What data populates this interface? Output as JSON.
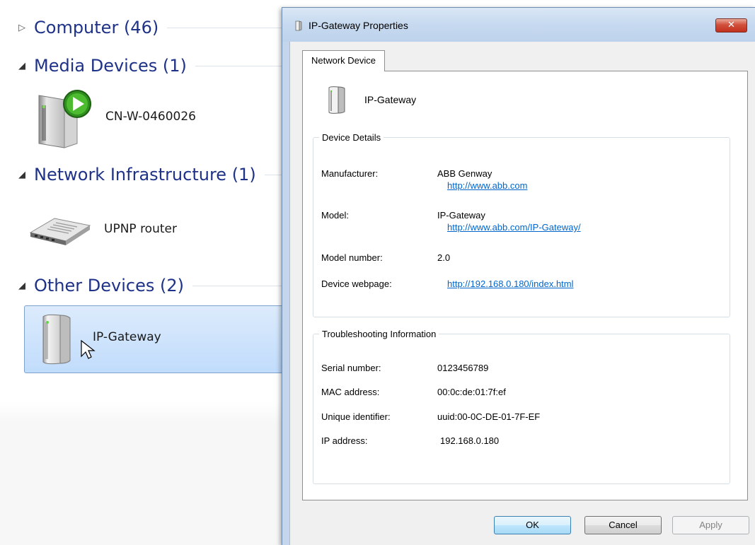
{
  "explorer": {
    "groups": [
      {
        "label": "Computer (46)",
        "expanded": false
      },
      {
        "label": "Media Devices (1)",
        "expanded": true,
        "items": [
          "CN-W-0460026"
        ]
      },
      {
        "label": "Network Infrastructure (1)",
        "expanded": true,
        "items": [
          "UPNP router"
        ]
      },
      {
        "label": "Other Devices (2)",
        "expanded": true,
        "items": [
          "IP-Gateway"
        ]
      }
    ],
    "selected_item": "IP-Gateway"
  },
  "dialog": {
    "title": "IP-Gateway Properties",
    "close_glyph": "✕",
    "tab_label": "Network Device",
    "device_name": "IP-Gateway",
    "device_details": {
      "legend": "Device Details",
      "manufacturer_label": "Manufacturer:",
      "manufacturer_value": "ABB Genway",
      "manufacturer_link": "http://www.abb.com",
      "model_label": "Model:",
      "model_value": "IP-Gateway",
      "model_link": "http://www.abb.com/IP-Gateway/",
      "model_number_label": "Model number:",
      "model_number_value": "2.0",
      "webpage_label": "Device webpage:",
      "webpage_link": "http://192.168.0.180/index.html"
    },
    "troubleshooting": {
      "legend": "Troubleshooting Information",
      "serial_label": "Serial number:",
      "serial_value": "0123456789",
      "mac_label": "MAC address:",
      "mac_value": "00:0c:de:01:7f:ef",
      "uid_label": "Unique identifier:",
      "uid_value": "uuid:00-0C-DE-01-7F-EF",
      "ip_label": "IP address:",
      "ip_value": "192.168.0.180"
    },
    "buttons": {
      "ok": "OK",
      "cancel": "Cancel",
      "apply": "Apply"
    }
  },
  "icons": {
    "collapsed_arrow": "collapsed-arrow-icon",
    "expanded_arrow": "expanded-arrow-icon",
    "media_device": "media-device-icon",
    "router": "router-icon",
    "gateway": "gateway-device-icon",
    "cursor": "mouse-cursor-icon"
  },
  "colors": {
    "group_title": "#1e3287",
    "selection_bg": "#c1dcfc",
    "link": "#0066cc",
    "close_button": "#c2311c"
  }
}
